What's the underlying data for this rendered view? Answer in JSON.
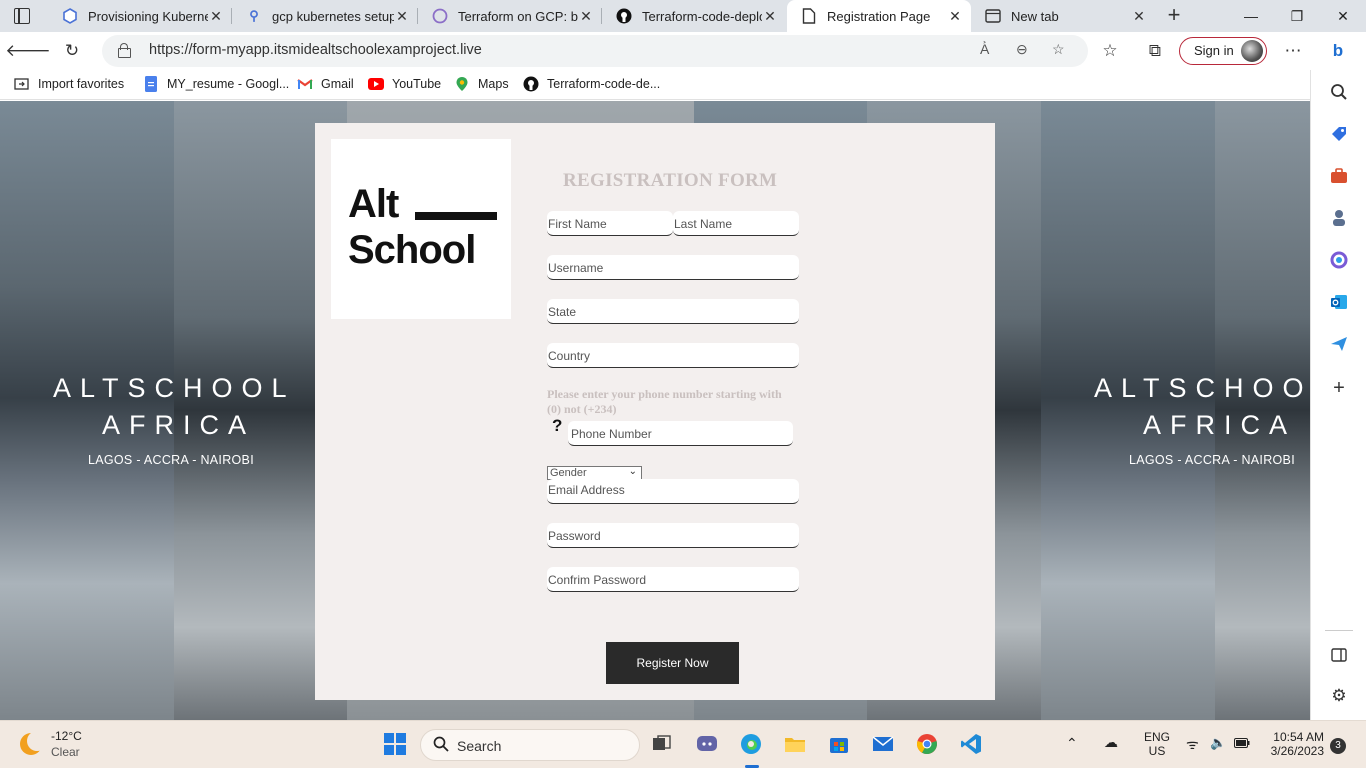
{
  "browser": {
    "tabs": [
      {
        "label": "Provisioning Kubernete",
        "favicon": "kubernetes-icon"
      },
      {
        "label": "gcp kubernetes setup f",
        "favicon": "search-icon"
      },
      {
        "label": "Terraform on GCP: buil",
        "favicon": "circle-icon"
      },
      {
        "label": "Terraform-code-deploy",
        "favicon": "github-icon"
      },
      {
        "label": "Registration Page",
        "favicon": "page-icon",
        "active": true
      },
      {
        "label": "New tab",
        "favicon": "newtab-icon"
      }
    ],
    "url": "https://form-myapp.itsmidealtschoolexamproject.live",
    "sign_in_label": "Sign in",
    "favorites": [
      {
        "label": "Import favorites",
        "icon": "import-icon"
      },
      {
        "label": "MY_resume - Googl...",
        "icon": "docs-icon"
      },
      {
        "label": "Gmail",
        "icon": "gmail-icon"
      },
      {
        "label": "YouTube",
        "icon": "youtube-icon"
      },
      {
        "label": "Maps",
        "icon": "maps-icon"
      },
      {
        "label": "Terraform-code-de...",
        "icon": "github-icon"
      }
    ]
  },
  "background": {
    "heading_line1": "ALTSCHOOL",
    "heading_line2": "AFRICA",
    "subheading": "LAGOS - ACCRA - NAIROBI"
  },
  "logo": {
    "line1": "Alt",
    "line2": "School"
  },
  "form": {
    "title": "REGISTRATION FORM",
    "first_name_placeholder": "First Name",
    "last_name_placeholder": "Last Name",
    "username_placeholder": "Username",
    "state_placeholder": "State",
    "country_placeholder": "Country",
    "phone_hint": "Please enter your phone number starting with (0) not (+234)",
    "phone_help": "?",
    "phone_placeholder": "Phone Number",
    "gender_selected": "Gender",
    "email_placeholder": "Email Address",
    "password_placeholder": "Password",
    "confirm_password_placeholder": "Confrim Password",
    "register_label": "Register Now"
  },
  "taskbar": {
    "weather_temp": "-12°C",
    "weather_cond": "Clear",
    "search_label": "Search",
    "lang_line1": "ENG",
    "lang_line2": "US",
    "time": "10:54 AM",
    "date": "3/26/2023",
    "notifications": "3"
  }
}
